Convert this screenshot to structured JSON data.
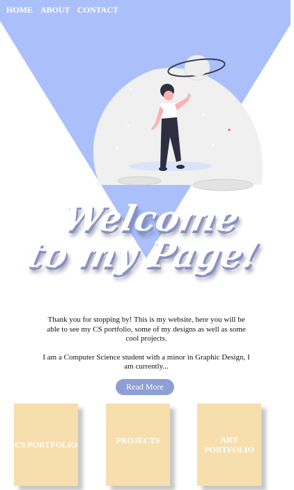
{
  "nav": {
    "items": [
      "HOME",
      "ABOUT",
      "CONTACT"
    ]
  },
  "hero": {
    "title_line1": "Welcome",
    "title_line2": "to my Page!"
  },
  "intro": {
    "paragraph1": "Thank you for stopping by! This is my website, here you will be able to see my CS portfolio, some of my designs as well as some cool projects.",
    "paragraph2": "I am a Computer Science student with a minor in Graphic Design, I am currently..."
  },
  "read_more_label": "Read More",
  "cards": [
    {
      "label": "CS PORTFOLIO"
    },
    {
      "label": "PROJECTS"
    },
    {
      "label": "ART PORTFOLIO"
    }
  ],
  "colors": {
    "nav_bg": "#abc0fb",
    "triangle": "#abc0fb",
    "button": "#8e9ed6",
    "card": "#f6dfad"
  }
}
